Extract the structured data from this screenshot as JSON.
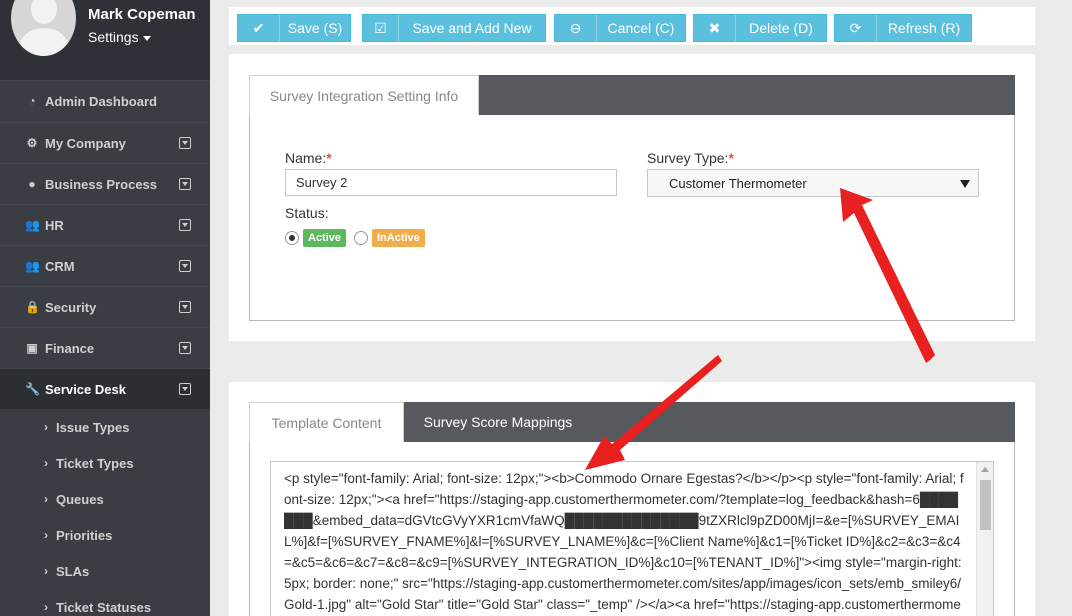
{
  "user": {
    "name": "Mark Copeman",
    "settings_label": "Settings"
  },
  "sidebar": {
    "items": [
      {
        "label": "Admin Dashboard",
        "icon": "dashboard-icon"
      },
      {
        "label": "My Company",
        "icon": "gear-icon"
      },
      {
        "label": "Business Process",
        "icon": "globe-icon"
      },
      {
        "label": "HR",
        "icon": "users-icon"
      },
      {
        "label": "CRM",
        "icon": "users-icon"
      },
      {
        "label": "Security",
        "icon": "lock-icon"
      },
      {
        "label": "Finance",
        "icon": "finance-icon"
      },
      {
        "label": "Service Desk",
        "icon": "wrench-icon"
      }
    ],
    "sub_items": [
      "Issue Types",
      "Ticket Types",
      "Queues",
      "Priorities",
      "SLAs",
      "Ticket Statuses"
    ]
  },
  "toolbar": {
    "save_label": "Save (S)",
    "save_add_label": "Save and Add New",
    "cancel_label": "Cancel (C)",
    "delete_label": "Delete (D)",
    "refresh_label": "Refresh (R)"
  },
  "info_panel": {
    "tab_label": "Survey Integration Setting Info",
    "name_label": "Name:",
    "name_value": "Survey 2",
    "survey_type_label": "Survey Type:",
    "survey_type_value": "Customer Thermometer",
    "status_label": "Status:",
    "status_active": "Active",
    "status_inactive": "InActive",
    "required_mark": "*"
  },
  "template_panel": {
    "tab_template": "Template Content",
    "tab_mappings": "Survey Score Mappings",
    "content": "<p style=\"font-family: Arial; font-size: 12px;\"><b>Commodo Ornare Egestas?</b></p><p style=\"font-family: Arial; font-size: 12px;\"><a href=\"https://staging-app.customerthermometer.com/?template=log_feedback&hash=6███████&embed_data=dGVtcGVyYXR1cmVfaWQ██████████████9tZXRlcl9pZD00MjI=&e=[%SURVEY_EMAIL%]&f=[%SURVEY_FNAME%]&l=[%SURVEY_LNAME%]&c=[%Client Name%]&c1=[%Ticket ID%]&c2=&c3=&c4=&c5=&c6=&c7=&c8=&c9=[%SURVEY_INTEGRATION_ID%]&c10=[%TENANT_ID%]\"><img style=\"margin-right: 5px; border: none;\" src=\"https://staging-app.customerthermometer.com/sites/app/images/icon_sets/emb_smiley6/Gold-1.jpg\" alt=\"Gold Star\" title=\"Gold Star\" class=\"_temp\" /></a><a href=\"https://staging-app.customerthermometer.com/?"
  },
  "colors": {
    "accent": "#5bc0de",
    "active_badge": "#5cb85c",
    "inactive_badge": "#f0ad4e",
    "arrow": "#e8201f"
  }
}
